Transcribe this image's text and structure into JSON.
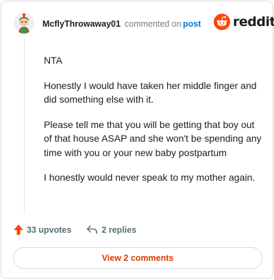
{
  "header": {
    "author": "McflyThrowaway01",
    "commented_text": "commented on",
    "post_link": "post",
    "brand": "reddit",
    "brand_color": "#ff4500"
  },
  "comment": {
    "paragraphs": [
      "NTA",
      "Honestly I would have taken her middle finger and did something else with it.",
      "Please tell me that you will be getting that boy out of that house ASAP and she won't be spending any time with you or your new baby postpartum",
      "I honestly would never speak to my mother again."
    ]
  },
  "footer": {
    "upvotes": "33 upvotes",
    "replies": "2 replies",
    "upvote_icon": "upvote-arrow-icon",
    "reply_icon": "reply-arrow-icon",
    "upvote_color": "#ff4500",
    "view_comments": "View 2 comments",
    "view_color": "#d93a00"
  }
}
